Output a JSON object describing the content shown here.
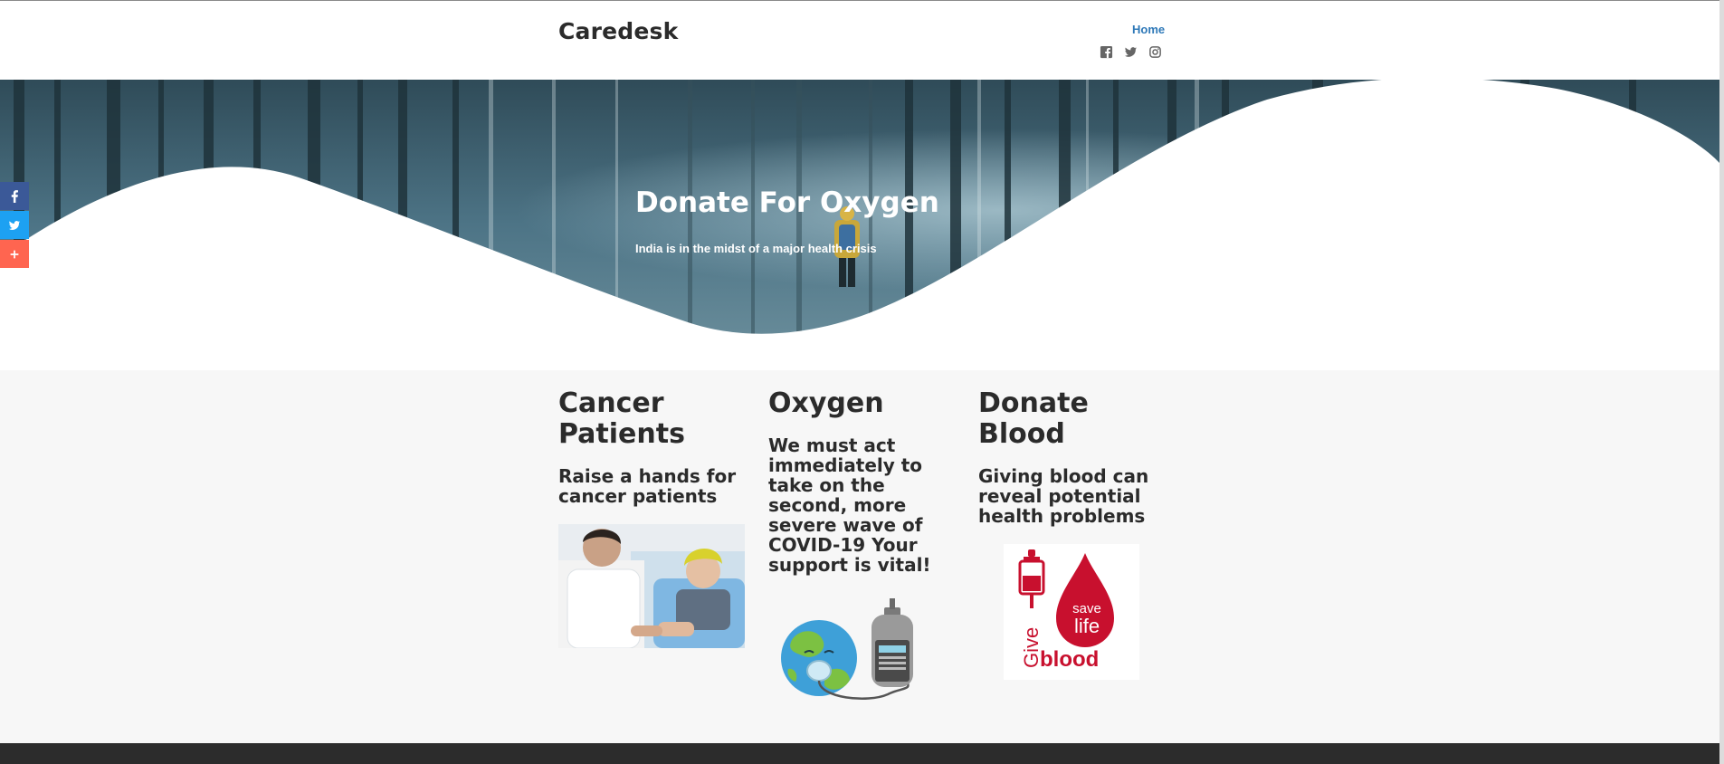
{
  "header": {
    "brand": "Caredesk",
    "nav": {
      "home": "Home"
    },
    "social_icons": [
      "facebook-icon",
      "twitter-icon",
      "instagram-icon"
    ]
  },
  "hero": {
    "title": "Donate For Oxygen",
    "subtitle": "India is in the midst of a major health crisis"
  },
  "share_bar": [
    {
      "icon": "facebook-icon",
      "color": "#3b5998"
    },
    {
      "icon": "twitter-icon",
      "color": "#1da1f2"
    },
    {
      "icon": "plus-icon",
      "color": "#ff6550"
    }
  ],
  "columns": [
    {
      "title": "Cancer Patients",
      "text": "Raise a hands for cancer patients",
      "image": "doctor-and-cancer-patient-photo"
    },
    {
      "title": "Oxygen",
      "text": "We must act immediately to take on the second, more severe wave of COVID-19 Your support is vital!",
      "image": "earth-with-oxygen-concentrator-illustration"
    },
    {
      "title": "Donate Blood",
      "text": "Giving blood can reveal potential health problems",
      "image": "give-blood-save-life-logo",
      "logo_text": {
        "give": "Give",
        "save": "save",
        "life": "life",
        "blood": "blood"
      }
    }
  ],
  "colors": {
    "brand_text": "#2b2b2b",
    "nav_link": "#2f79b8",
    "section_bg": "#f7f7f7",
    "footer_bg": "#2c2c2c",
    "blood_red": "#c8102e"
  }
}
